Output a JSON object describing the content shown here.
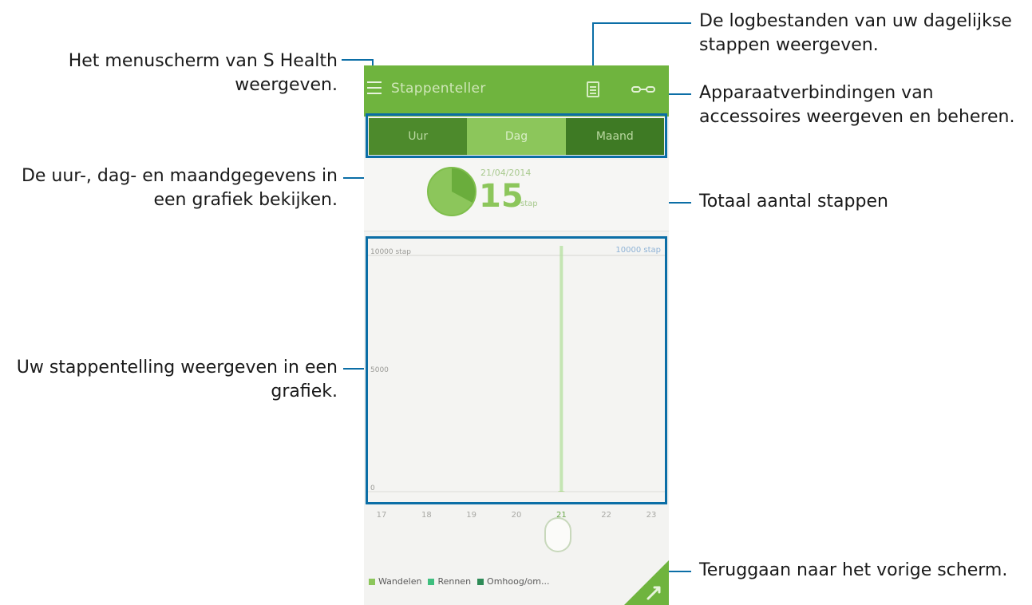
{
  "callouts": {
    "menu": "Het menuscherm van S Health weergeven.",
    "tabs": "De uur-, dag- en maandgegevens in een grafiek bekijken.",
    "graph": "Uw stappentelling weergeven in een grafiek.",
    "logs": "De logbestanden van uw dagelijkse stappen weergeven.",
    "accessories": "Apparaatverbindingen van accessoires weergeven en beheren.",
    "total": "Totaal aantal stappen",
    "back": "Teruggaan naar het vorige scherm."
  },
  "app": {
    "title": "Stappenteller",
    "tabs": [
      "Uur",
      "Dag",
      "Maand"
    ],
    "selected_tab": "Dag",
    "date": "21/04/2014",
    "step_count": "15",
    "step_unit": "stap",
    "goal_label": "10000 stap"
  },
  "legend": [
    "Wandelen",
    "Rennen",
    "Omhoog/om..."
  ],
  "colors": {
    "appbar": "#6fb43e",
    "accent": "#8cc65b",
    "callout_line": "#0b6ea6",
    "walking": "#8cc65b",
    "running": "#3fbf7f",
    "updown": "#2e8b57"
  },
  "chart_data": {
    "type": "bar",
    "categories": [
      "17",
      "18",
      "19",
      "20",
      "21",
      "22",
      "23"
    ],
    "values": [
      0,
      0,
      0,
      0,
      15,
      0,
      0
    ],
    "selected": "21",
    "ylim": [
      0,
      10000
    ],
    "y_ticks": [
      "10000 stap",
      "5000",
      "0"
    ],
    "goal": 10000,
    "goal_label": "10000 stap"
  }
}
